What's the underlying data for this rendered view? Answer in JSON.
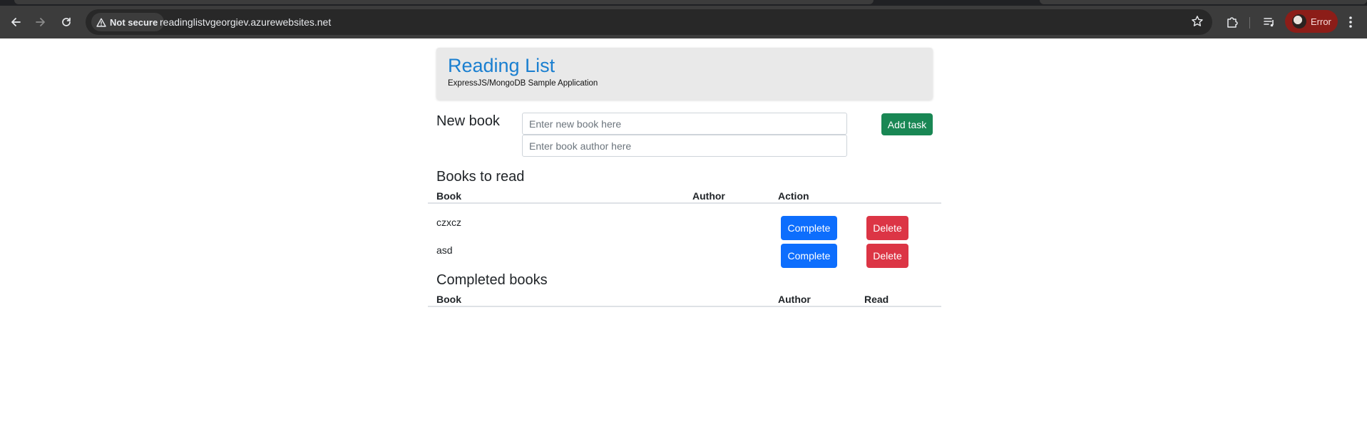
{
  "browser": {
    "nav": {
      "back_icon": "arrow-left-icon",
      "forward_icon": "arrow-right-icon",
      "reload_icon": "reload-icon"
    },
    "security_label": "Not secure",
    "url": "readinglistvgeorgiev.azurewebsites.net",
    "profile_label": "Error",
    "colors": {
      "frame": "#202124",
      "toolbar": "#3c3c3c",
      "omnibox": "#282828",
      "profile_chip": "#8c1d18"
    }
  },
  "app": {
    "title": "Reading List",
    "subtitle": "ExpressJS/MongoDB Sample Application"
  },
  "new_book": {
    "label": "New book",
    "book_placeholder": "Enter new book here",
    "author_placeholder": "Enter book author here",
    "book_value": "",
    "author_value": "",
    "add_button": "Add task"
  },
  "to_read": {
    "title": "Books to read",
    "columns": [
      "Book",
      "Author",
      "Action"
    ],
    "rows": [
      {
        "book": "czxcz",
        "author": "",
        "complete_label": "Complete",
        "delete_label": "Delete"
      },
      {
        "book": "asd",
        "author": "",
        "complete_label": "Complete",
        "delete_label": "Delete"
      }
    ]
  },
  "completed": {
    "title": "Completed books",
    "columns": [
      "Book",
      "Author",
      "Read"
    ],
    "rows": []
  },
  "colors": {
    "title_blue": "#1a7fd0",
    "add_green": "#198754",
    "complete_blue": "#0d6efd",
    "delete_red": "#dc3545"
  }
}
